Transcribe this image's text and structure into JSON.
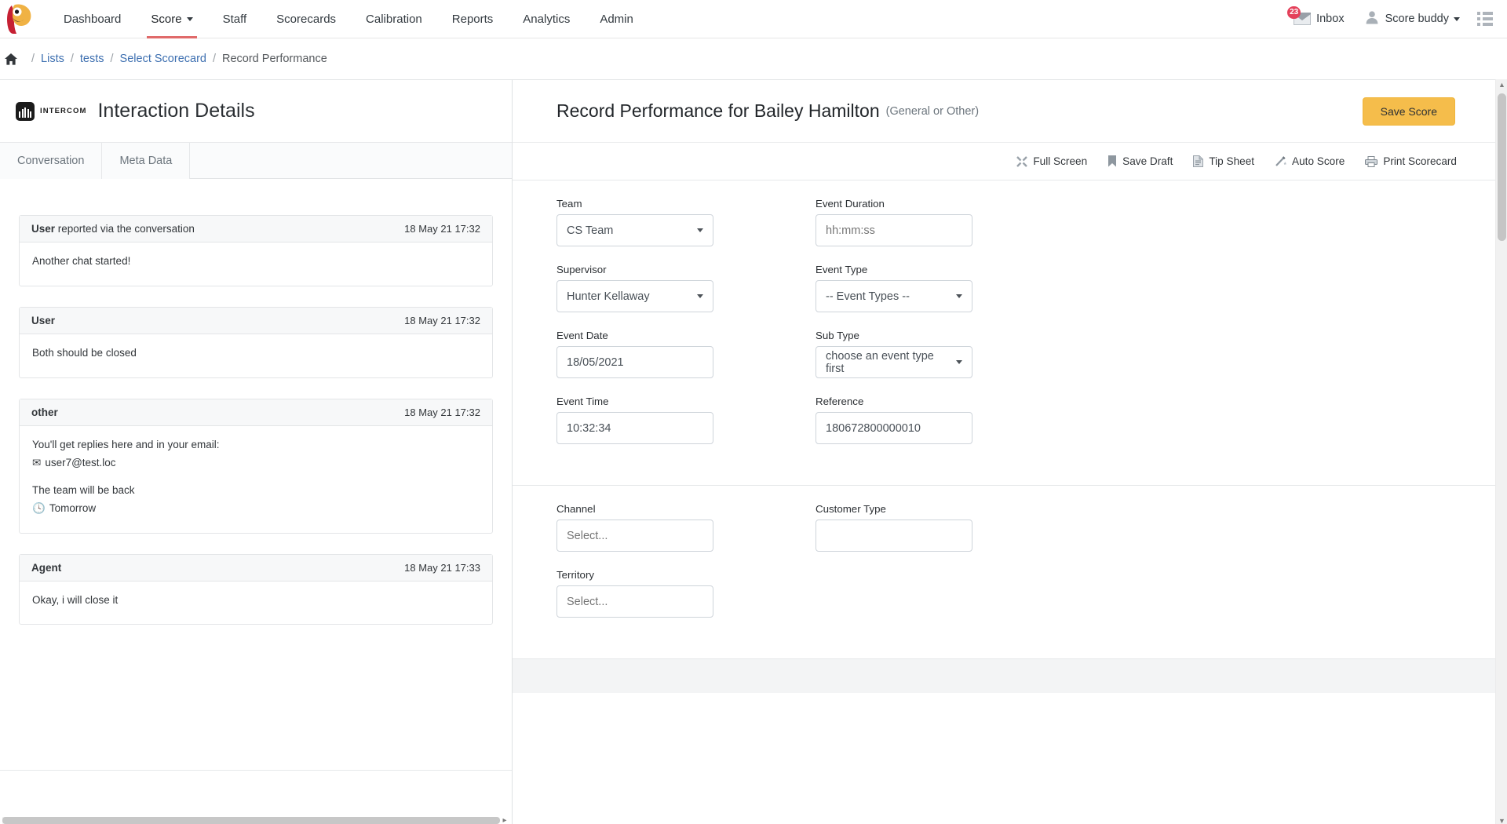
{
  "topnav": {
    "logo_icon": "parrot-logo",
    "items": [
      {
        "label": "Dashboard",
        "has_caret": false,
        "active": false
      },
      {
        "label": "Score",
        "has_caret": true,
        "active": true
      },
      {
        "label": "Staff",
        "has_caret": false,
        "active": false
      },
      {
        "label": "Scorecards",
        "has_caret": false,
        "active": false
      },
      {
        "label": "Calibration",
        "has_caret": false,
        "active": false
      },
      {
        "label": "Reports",
        "has_caret": false,
        "active": false
      },
      {
        "label": "Analytics",
        "has_caret": false,
        "active": false
      },
      {
        "label": "Admin",
        "has_caret": false,
        "active": false
      }
    ],
    "inbox": {
      "label": "Inbox",
      "badge": "23",
      "icon": "envelope-icon"
    },
    "user": {
      "label": "Score buddy",
      "icon": "user-avatar-icon"
    },
    "menu_icon": "list-menu-icon",
    "accent_color": "#e06a6a",
    "badge_color": "#e4405a"
  },
  "breadcrumb": {
    "home_icon": "home-icon",
    "items": [
      {
        "label": "Lists",
        "link": true
      },
      {
        "label": "tests",
        "link": true
      },
      {
        "label": "Select Scorecard",
        "link": true
      },
      {
        "label": "Record Performance",
        "link": false
      }
    ],
    "separator": "/"
  },
  "left_panel": {
    "source_badge": "INTERCOM",
    "source_icon": "intercom-icon",
    "title": "Interaction Details",
    "tabs": [
      {
        "label": "Conversation",
        "active": true
      },
      {
        "label": "Meta Data",
        "active": false
      }
    ],
    "messages": [
      {
        "author": "User",
        "suffix": " reported via the conversation",
        "time": "18 May 21 17:32",
        "lines": [
          {
            "text": "Another chat started!",
            "icon": null
          }
        ]
      },
      {
        "author": "User",
        "suffix": "",
        "time": "18 May 21 17:32",
        "lines": [
          {
            "text": "Both should be closed",
            "icon": null
          }
        ]
      },
      {
        "author": "other",
        "suffix": "",
        "time": "18 May 21 17:32",
        "lines": [
          {
            "text": "You'll get replies here and in your email:",
            "icon": null
          },
          {
            "text": "user7@test.loc",
            "icon": "✉"
          },
          {
            "text": "The team will be back",
            "icon": null
          },
          {
            "text": "Tomorrow",
            "icon": "🕓"
          }
        ]
      },
      {
        "author": "Agent",
        "suffix": "",
        "time": "18 May 21 17:33",
        "lines": [
          {
            "text": "Okay, i will close it",
            "icon": null
          }
        ]
      }
    ]
  },
  "right_panel": {
    "title": "Record Performance for Bailey Hamilton",
    "subtitle": "(General or Other)",
    "save_button": "Save Score",
    "save_button_color": "#f5bd4b",
    "toolbar": [
      {
        "label": "Full Screen",
        "icon": "fullscreen-icon"
      },
      {
        "label": "Save Draft",
        "icon": "bookmark-icon"
      },
      {
        "label": "Tip Sheet",
        "icon": "document-icon"
      },
      {
        "label": "Auto Score",
        "icon": "wand-icon"
      },
      {
        "label": "Print Scorecard",
        "icon": "printer-icon"
      }
    ],
    "fields_section_1": [
      {
        "label": "Team",
        "type": "select",
        "value": "CS Team",
        "placeholder": ""
      },
      {
        "label": "Event Duration",
        "type": "text",
        "value": "",
        "placeholder": "hh:mm:ss"
      },
      {
        "label": "Supervisor",
        "type": "select",
        "value": "Hunter Kellaway",
        "placeholder": ""
      },
      {
        "label": "Event Type",
        "type": "select",
        "value": "-- Event Types --",
        "placeholder": ""
      },
      {
        "label": "Event Date",
        "type": "text",
        "value": "18/05/2021",
        "placeholder": ""
      },
      {
        "label": "Sub Type",
        "type": "select",
        "value": "choose an event type first",
        "placeholder": ""
      },
      {
        "label": "Event Time",
        "type": "text",
        "value": "10:32:34",
        "placeholder": ""
      },
      {
        "label": "Reference",
        "type": "text",
        "value": "180672800000010",
        "placeholder": ""
      }
    ],
    "fields_section_2": [
      {
        "label": "Channel",
        "type": "text",
        "value": "",
        "placeholder": "Select..."
      },
      {
        "label": "Customer Type",
        "type": "text",
        "value": "",
        "placeholder": ""
      },
      {
        "label": "Territory",
        "type": "text",
        "value": "",
        "placeholder": "Select..."
      }
    ]
  }
}
